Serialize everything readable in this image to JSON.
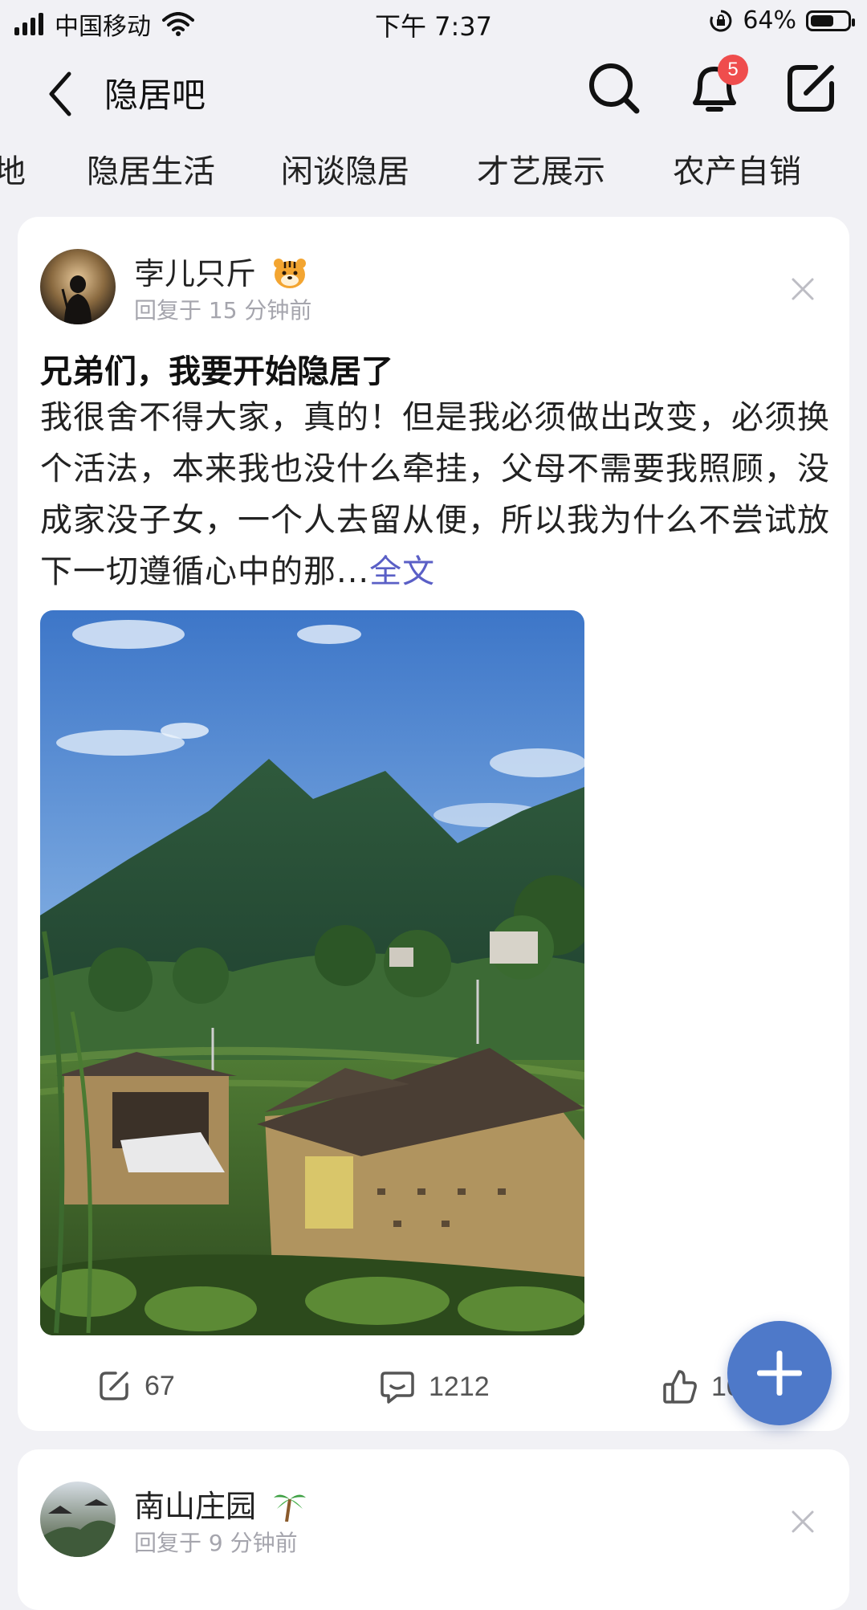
{
  "status_bar": {
    "carrier": "中国移动",
    "time": "下午 7:37",
    "battery": "64%",
    "battery_level": 0.64
  },
  "nav": {
    "title": "隐居吧",
    "notification_count": "5"
  },
  "tabs": [
    "地",
    "隐居生活",
    "闲谈隐居",
    "才艺展示",
    "农产自销"
  ],
  "post": {
    "author": "孛儿只斤",
    "meta": "回复于 15 分钟前",
    "title": "兄弟们，我要开始隐居了",
    "body": "我很舍不得大家，真的！但是我必须做出改变，必须换个活法，本来我也没什么牵挂，父母不需要我照顾，没成家没子女，一个人去留从便，所以我为什么不尝试放下一切遵循心中的那...",
    "full_text_link": "全文",
    "share_count": "67",
    "comment_count": "1212",
    "like_count": "10"
  },
  "next_post": {
    "author": "南山庄园",
    "meta": "回复于 9 分钟前"
  },
  "colors": {
    "background": "#f1f1f5",
    "link": "#5a5fc6",
    "badge": "#ef4d4d",
    "fab": "#4e79c9"
  },
  "icons": [
    "signal-icon",
    "wifi-icon",
    "rotation-lock-icon",
    "battery-icon",
    "back-icon",
    "search-icon",
    "bell-icon",
    "edit-icon",
    "tiger-emoji-icon",
    "close-icon",
    "share-icon",
    "comment-icon",
    "like-icon",
    "plus-icon",
    "palm-tree-emoji-icon"
  ]
}
